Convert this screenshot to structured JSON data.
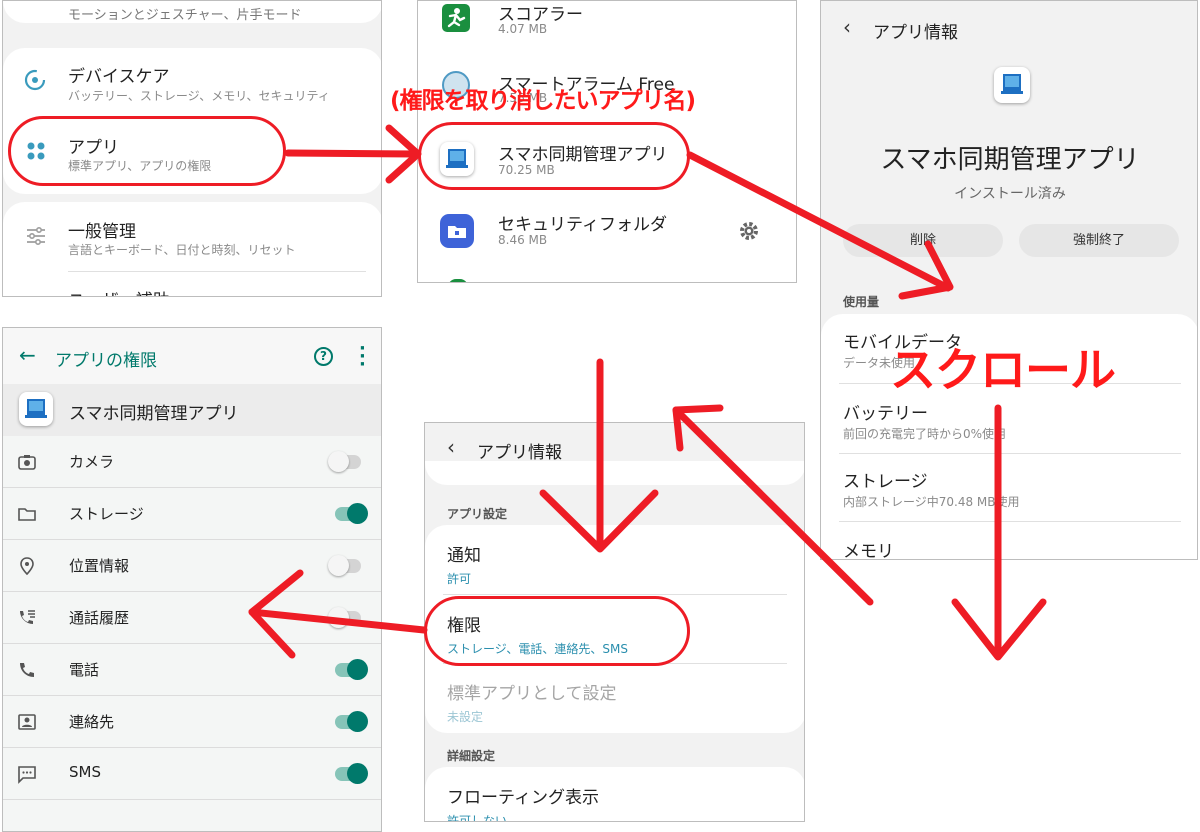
{
  "settings_panel": {
    "top_partial": "モーションとジェスチャー、片手モード",
    "items": [
      {
        "title": "デバイスケア",
        "sub": "バッテリー、ストレージ、メモリ、セキュリティ"
      },
      {
        "title": "アプリ",
        "sub": "標準アプリ、アプリの権限"
      },
      {
        "title": "一般管理",
        "sub": "言語とキーボード、日付と時刻、リセット"
      },
      {
        "title": "ユーザー補助"
      }
    ]
  },
  "apps_list": {
    "items": [
      {
        "name": "スコアラー",
        "size": "4.07 MB"
      },
      {
        "name": "スマートアラーム Free",
        "size": "7.56 MB"
      },
      {
        "name": "スマホ同期管理アプリ",
        "size": "70.25 MB"
      },
      {
        "name": "セキュリティフォルダ",
        "size": "8.46 MB"
      }
    ]
  },
  "annotations": {
    "revoke_label": "(権限を取り消したいアプリ名)",
    "scroll_label": "スクロール"
  },
  "app_info_top": {
    "header": "アプリ情報",
    "app_name": "スマホ同期管理アプリ",
    "status": "インストール済み",
    "delete_btn": "削除",
    "force_stop_btn": "強制終了",
    "usage_section": "使用量",
    "rows": [
      {
        "title": "モバイルデータ",
        "sub": "データ未使用"
      },
      {
        "title": "バッテリー",
        "sub": "前回の充電完了時から0%使用"
      },
      {
        "title": "ストレージ",
        "sub": "内部ストレージ中70.48 MB使用"
      },
      {
        "title": "メモリ"
      }
    ]
  },
  "app_info_scrolled": {
    "header": "アプリ情報",
    "section_app": "アプリ設定",
    "notif_title": "通知",
    "notif_sub": "許可",
    "perm_title": "権限",
    "perm_sub": "ストレージ、電話、連絡先、SMS",
    "default_title": "標準アプリとして設定",
    "default_sub": "未設定",
    "section_adv": "詳細設定",
    "float_title": "フローティング表示",
    "float_sub": "許可しない"
  },
  "permissions_panel": {
    "title": "アプリの権限",
    "app_name": "スマホ同期管理アプリ",
    "items": [
      {
        "label": "カメラ",
        "icon": "camera-icon",
        "enabled": false
      },
      {
        "label": "ストレージ",
        "icon": "folder-icon",
        "enabled": true
      },
      {
        "label": "位置情報",
        "icon": "location-pin-icon",
        "enabled": false
      },
      {
        "label": "通話履歴",
        "icon": "call-log-icon",
        "enabled": false
      },
      {
        "label": "電話",
        "icon": "phone-icon",
        "enabled": true
      },
      {
        "label": "連絡先",
        "icon": "contacts-icon",
        "enabled": true
      },
      {
        "label": "SMS",
        "icon": "sms-icon",
        "enabled": true
      }
    ]
  },
  "colors": {
    "accent_teal": "#00796b",
    "annotation_red": "#ee1c25",
    "panel_bg": "#f2f2f2"
  }
}
